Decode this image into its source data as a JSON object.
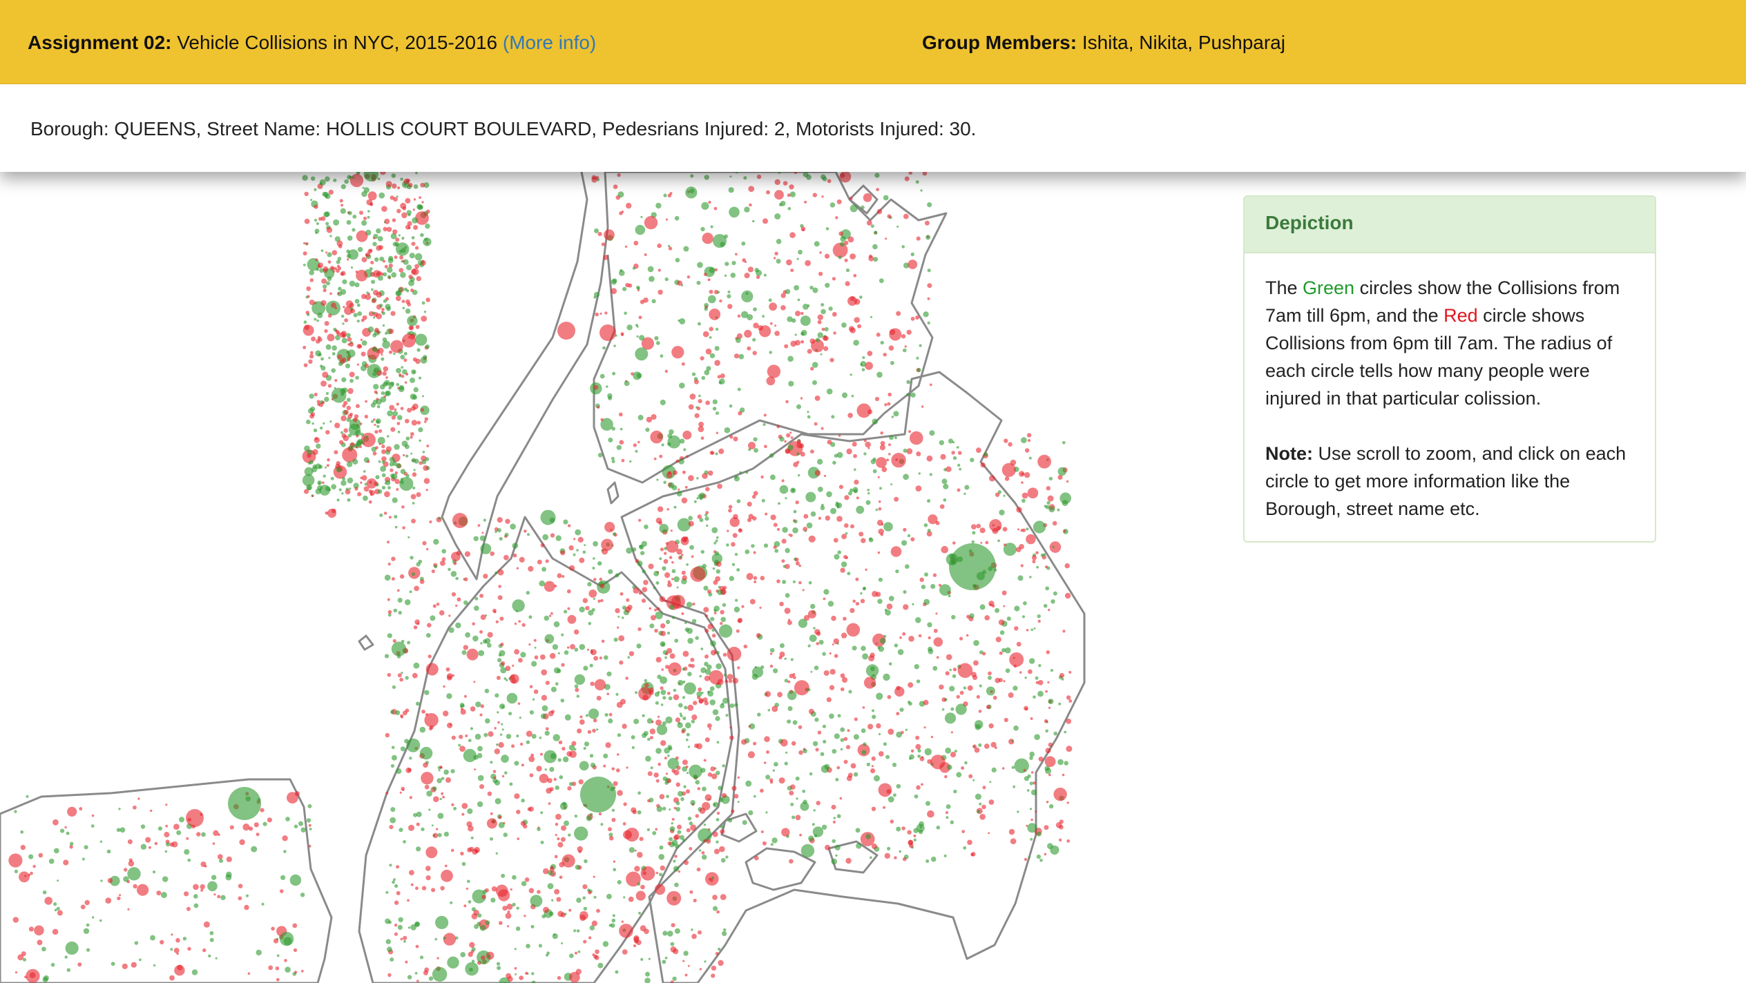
{
  "header": {
    "assignment_label": "Assignment 02:",
    "assignment_title": "Vehicle Collisions in NYC, 2015-2016",
    "more_info": "(More info)",
    "members_label": "Group Members:",
    "members_names": "Ishita, Nikita, Pushparaj"
  },
  "info": {
    "text": "Borough: QUEENS, Street Name: HOLLIS COURT BOULEVARD, Pedesrians Injured: 2, Motorists Injured: 30."
  },
  "panel": {
    "title": "Depiction",
    "p1_a": "The ",
    "p1_green": "Green",
    "p1_b": " circles show the Collisions from 7am till 6pm, and the ",
    "p1_red": "Red",
    "p1_c": " circle shows Collisions from 6pm till 7am. The radius of each circle tells how many people were injured in that particular colission.",
    "note_label": "Note:",
    "note_text": " Use scroll to zoom, and click on each circle to get more information like the Borough, street name etc."
  },
  "colors": {
    "header_bg": "#efc230",
    "link": "#3278b4",
    "day_circle": "#2e9a2e",
    "night_circle": "#e8262e",
    "panel_heading": "#3b7a3c",
    "panel_heading_bg": "#def0d8",
    "outline": "#8a8a8a"
  },
  "map": {
    "legend_classes": [
      "day",
      "night"
    ]
  }
}
